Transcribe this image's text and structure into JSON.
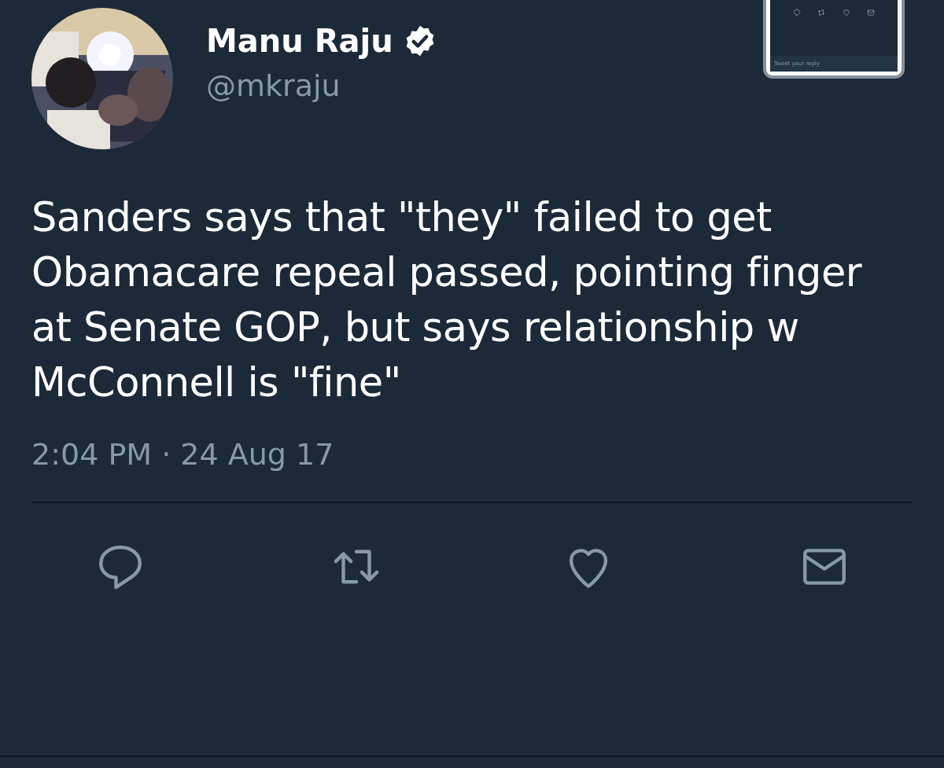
{
  "tweet": {
    "author_name": "Manu Raju",
    "verified": true,
    "handle": "@mkraju",
    "text": "Sanders says that \"they\" failed to get Obamacare repeal passed, pointing finger at Senate GOP, but says relationship w McConnell is \"fine\"",
    "timestamp": "2:04 PM · 24 Aug 17"
  },
  "actions": [
    {
      "kind": "reply"
    },
    {
      "kind": "retweet"
    },
    {
      "kind": "like"
    },
    {
      "kind": "message"
    }
  ],
  "inset": {
    "reply_placeholder": "Tweet your reply"
  }
}
